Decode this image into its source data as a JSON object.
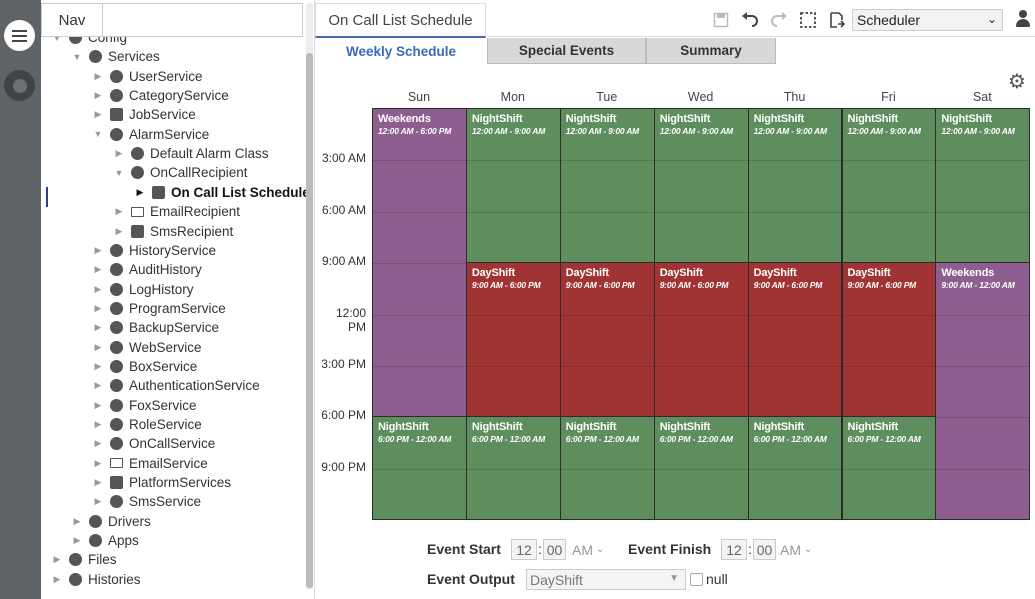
{
  "nav": {
    "tab_label": "Nav",
    "tree": [
      {
        "label": "Config",
        "indent": 0,
        "arrow": "▼",
        "icon": "config-icon"
      },
      {
        "label": "Services",
        "indent": 1,
        "arrow": "▼",
        "icon": "services-icon"
      },
      {
        "label": "UserService",
        "indent": 2,
        "arrow": "▶",
        "icon": "user-service-icon"
      },
      {
        "label": "CategoryService",
        "indent": 2,
        "arrow": "▶",
        "icon": "category-service-icon"
      },
      {
        "label": "JobService",
        "indent": 2,
        "arrow": "▶",
        "icon": "job-service-icon"
      },
      {
        "label": "AlarmService",
        "indent": 2,
        "arrow": "▼",
        "icon": "alarm-service-icon"
      },
      {
        "label": "Default Alarm Class",
        "indent": 3,
        "arrow": "▶",
        "icon": "alarm-class-icon"
      },
      {
        "label": "OnCallRecipient",
        "indent": 3,
        "arrow": "▼",
        "icon": "oncall-recipient-icon"
      },
      {
        "label": "On Call List Schedule",
        "indent": 4,
        "arrow": "▶",
        "icon": "schedule-icon"
      },
      {
        "label": "EmailRecipient",
        "indent": 3,
        "arrow": "▶",
        "icon": "email-recipient-icon"
      },
      {
        "label": "SmsRecipient",
        "indent": 3,
        "arrow": "▶",
        "icon": "sms-recipient-icon"
      },
      {
        "label": "HistoryService",
        "indent": 2,
        "arrow": "▶",
        "icon": "history-service-icon"
      },
      {
        "label": "AuditHistory",
        "indent": 2,
        "arrow": "▶",
        "icon": "audit-history-icon"
      },
      {
        "label": "LogHistory",
        "indent": 2,
        "arrow": "▶",
        "icon": "log-history-icon"
      },
      {
        "label": "ProgramService",
        "indent": 2,
        "arrow": "▶",
        "icon": "program-service-icon"
      },
      {
        "label": "BackupService",
        "indent": 2,
        "arrow": "▶",
        "icon": "backup-service-icon"
      },
      {
        "label": "WebService",
        "indent": 2,
        "arrow": "▶",
        "icon": "web-service-icon"
      },
      {
        "label": "BoxService",
        "indent": 2,
        "arrow": "▶",
        "icon": "box-service-icon"
      },
      {
        "label": "AuthenticationService",
        "indent": 2,
        "arrow": "▶",
        "icon": "authentication-service-icon"
      },
      {
        "label": "FoxService",
        "indent": 2,
        "arrow": "▶",
        "icon": "fox-service-icon"
      },
      {
        "label": "RoleService",
        "indent": 2,
        "arrow": "▶",
        "icon": "role-service-icon"
      },
      {
        "label": "OnCallService",
        "indent": 2,
        "arrow": "▶",
        "icon": "oncall-service-icon"
      },
      {
        "label": "EmailService",
        "indent": 2,
        "arrow": "▶",
        "icon": "email-service-icon"
      },
      {
        "label": "PlatformServices",
        "indent": 2,
        "arrow": "▶",
        "icon": "platform-services-icon"
      },
      {
        "label": "SmsService",
        "indent": 2,
        "arrow": "▶",
        "icon": "sms-service-icon"
      },
      {
        "label": "Drivers",
        "indent": 1,
        "arrow": "▶",
        "icon": "drivers-icon"
      },
      {
        "label": "Apps",
        "indent": 1,
        "arrow": "▶",
        "icon": "apps-icon"
      },
      {
        "label": "Files",
        "indent": 0,
        "arrow": "▶",
        "icon": "files-icon"
      },
      {
        "label": "Histories",
        "indent": 0,
        "arrow": "▶",
        "icon": "histories-icon"
      }
    ]
  },
  "main": {
    "view_title": "On Call List Schedule",
    "view_selector": "Scheduler",
    "toolbar": [
      "save-icon",
      "undo-icon",
      "redo-icon",
      "select-all-icon",
      "export-icon"
    ],
    "subtabs": [
      {
        "label": "Weekly Schedule",
        "active": true
      },
      {
        "label": "Special Events",
        "active": false
      },
      {
        "label": "Summary",
        "active": false
      }
    ]
  },
  "calendar": {
    "days": [
      "Sun",
      "Mon",
      "Tue",
      "Wed",
      "Thu",
      "Fri",
      "Sat"
    ],
    "time_labels": [
      "3:00 AM",
      "6:00 AM",
      "9:00 AM",
      "12:00 PM",
      "3:00 PM",
      "6:00 PM",
      "9:00 PM"
    ],
    "colors": {
      "NightShift": "#5e8e5e",
      "DayShift": "#a03434",
      "Weekends": "#8e5e90"
    },
    "events": [
      {
        "day": 0,
        "start": 0,
        "end": 18,
        "name": "Weekends",
        "time": "12:00 AM - 6:00 PM"
      },
      {
        "day": 0,
        "start": 18,
        "end": 24,
        "name": "NightShift",
        "time": "6:00 PM - 12:00 AM"
      },
      {
        "day": 1,
        "start": 0,
        "end": 9,
        "name": "NightShift",
        "time": "12:00 AM - 9:00 AM"
      },
      {
        "day": 1,
        "start": 9,
        "end": 18,
        "name": "DayShift",
        "time": "9:00 AM - 6:00 PM"
      },
      {
        "day": 1,
        "start": 18,
        "end": 24,
        "name": "NightShift",
        "time": "6:00 PM - 12:00 AM"
      },
      {
        "day": 2,
        "start": 0,
        "end": 9,
        "name": "NightShift",
        "time": "12:00 AM - 9:00 AM"
      },
      {
        "day": 2,
        "start": 9,
        "end": 18,
        "name": "DayShift",
        "time": "9:00 AM - 6:00 PM"
      },
      {
        "day": 2,
        "start": 18,
        "end": 24,
        "name": "NightShift",
        "time": "6:00 PM - 12:00 AM"
      },
      {
        "day": 3,
        "start": 0,
        "end": 9,
        "name": "NightShift",
        "time": "12:00 AM - 9:00 AM"
      },
      {
        "day": 3,
        "start": 9,
        "end": 18,
        "name": "DayShift",
        "time": "9:00 AM - 6:00 PM"
      },
      {
        "day": 3,
        "start": 18,
        "end": 24,
        "name": "NightShift",
        "time": "6:00 PM - 12:00 AM"
      },
      {
        "day": 4,
        "start": 0,
        "end": 9,
        "name": "NightShift",
        "time": "12:00 AM - 9:00 AM"
      },
      {
        "day": 4,
        "start": 9,
        "end": 18,
        "name": "DayShift",
        "time": "9:00 AM - 6:00 PM"
      },
      {
        "day": 4,
        "start": 18,
        "end": 24,
        "name": "NightShift",
        "time": "6:00 PM - 12:00 AM"
      },
      {
        "day": 5,
        "start": 0,
        "end": 9,
        "name": "NightShift",
        "time": "12:00 AM - 9:00 AM"
      },
      {
        "day": 5,
        "start": 9,
        "end": 18,
        "name": "DayShift",
        "time": "9:00 AM - 6:00 PM"
      },
      {
        "day": 5,
        "start": 18,
        "end": 24,
        "name": "NightShift",
        "time": "6:00 PM - 12:00 AM"
      },
      {
        "day": 6,
        "start": 0,
        "end": 9,
        "name": "NightShift",
        "time": "12:00 AM - 9:00 AM"
      },
      {
        "day": 6,
        "start": 9,
        "end": 24,
        "name": "Weekends",
        "time": "9:00 AM - 12:00 AM"
      }
    ]
  },
  "form": {
    "event_start_label": "Event Start",
    "event_finish_label": "Event Finish",
    "event_output_label": "Event Output",
    "start_hour": "12",
    "start_minute": "00",
    "start_ampm": "AM",
    "finish_hour": "12",
    "finish_minute": "00",
    "finish_ampm": "AM",
    "output_value": "DayShift",
    "null_label": "null"
  }
}
